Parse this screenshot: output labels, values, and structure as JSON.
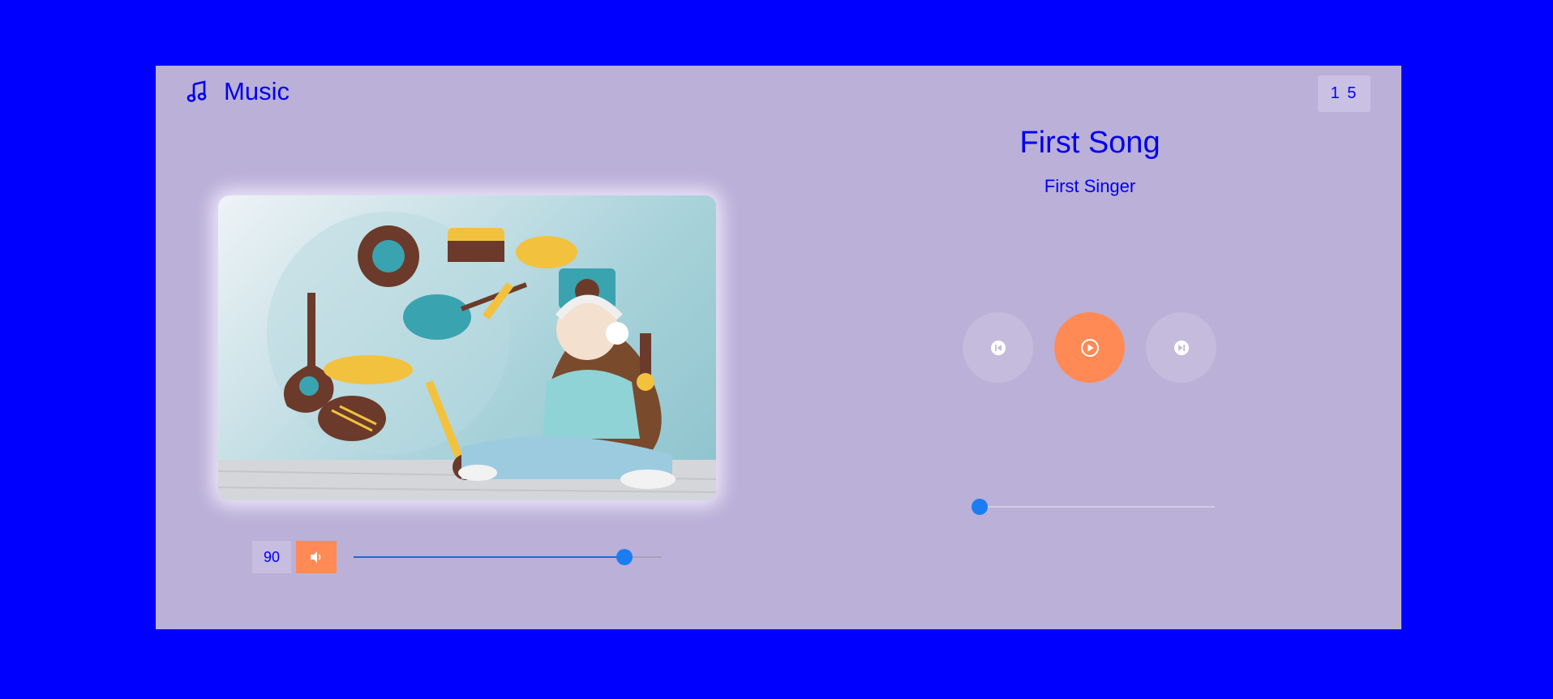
{
  "app": {
    "title": "Music",
    "icon": "music-note-icon"
  },
  "counter": "1 5",
  "song": {
    "title": "First Song",
    "artist": "First Singer"
  },
  "cover": {
    "description_icon": "album-art-image"
  },
  "volume": {
    "value": "90",
    "level": 0.88,
    "icon": "speaker-icon"
  },
  "controls": {
    "prev_icon": "skip-previous-icon",
    "play_icon": "play-icon",
    "next_icon": "skip-next-icon"
  },
  "progress": {
    "level": 0.0
  },
  "colors": {
    "page_bg": "#0000ff",
    "panel_bg": "#bbb0d8",
    "accent": "#ff8a55",
    "text": "#0000ee",
    "slider": "#1a7ef2"
  }
}
